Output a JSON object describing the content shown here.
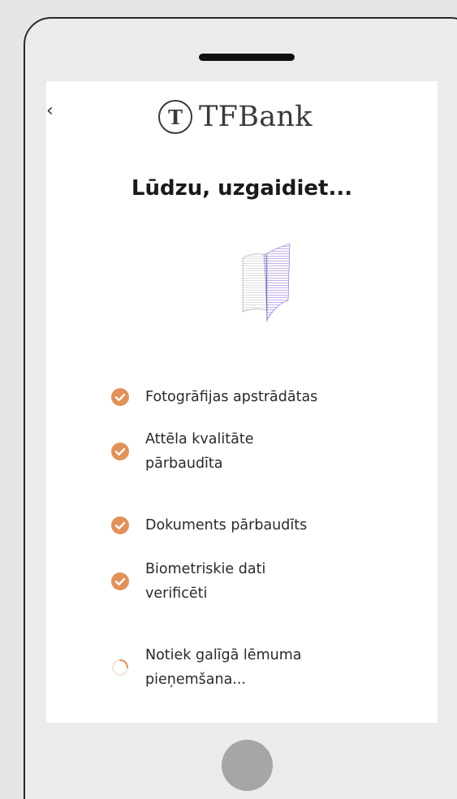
{
  "brand": {
    "logo_mark": "T",
    "logo_text": "TFBank"
  },
  "header": {
    "back_icon": "chevron-left-icon",
    "back_glyph": "‹"
  },
  "title": "Lūdzu, uzgaidiet...",
  "steps": [
    {
      "label": "Fotogrāfijas apstrādātas",
      "status": "done"
    },
    {
      "label": "Attēla kvalitāte pārbaudīta",
      "status": "done"
    },
    {
      "label": "Dokuments pārbaudīts",
      "status": "done"
    },
    {
      "label": "Biometriskie dati verificēti",
      "status": "done"
    },
    {
      "label": "Notiek galīgā lēmuma pieņemšana...",
      "status": "in-progress"
    }
  ],
  "colors": {
    "check": "#e0925a",
    "spinner": "#e0925a",
    "illustration_primary": "#8a5fd6",
    "illustration_secondary": "#bfc3cc"
  }
}
